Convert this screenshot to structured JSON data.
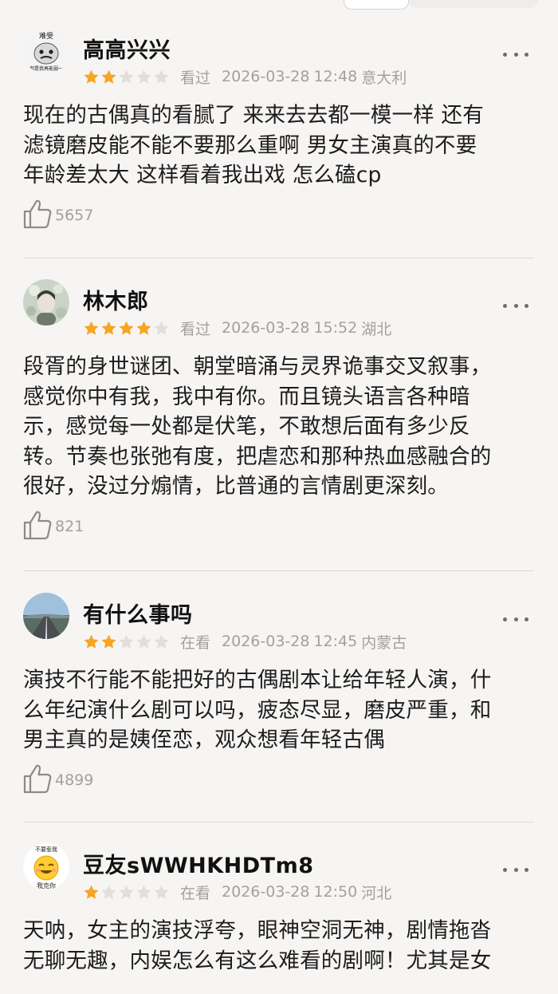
{
  "colors": {
    "background": "#f7f5f3",
    "star_filled": "#f5a623",
    "star_empty": "#e1dedb",
    "meta_text": "#a3a09d",
    "divider": "#dddad7"
  },
  "reviews": [
    {
      "username": "高高兴兴",
      "avatar": {
        "icon": "meme-avatar-icon",
        "caption_top": "难受",
        "caption_bottom": "但是我再能弱一"
      },
      "rating": 2,
      "status": "看过",
      "date": "2026-03-28",
      "time": "12:48",
      "location": "意大利",
      "content_lines": [
        "现在的古偶真的看腻了 来来去去都一模一样 还有",
        "滤镜磨皮能不能不要那么重啊 男女主演真的不要",
        "年龄差太大 这样看着我出戏 怎么磕cp"
      ],
      "likes": "5657",
      "like_icon": "thumbs-up-icon",
      "more_icon": "more-options-icon"
    },
    {
      "username": "林木郎",
      "avatar": {
        "icon": "portrait-avatar-icon"
      },
      "rating": 4,
      "status": "看过",
      "date": "2026-03-28",
      "time": "15:52",
      "location": "湖北",
      "content_lines": [
        "段胥的身世谜团、朝堂暗涌与灵界诡事交叉叙事，",
        "感觉你中有我，我中有你。而且镜头语言各种暗",
        "示，感觉每一处都是伏笔，不敢想后面有多少反",
        "转。节奏也张弛有度，把虐恋和那种热血感融合的",
        "很好，没过分煽情，比普通的言情剧更深刻。"
      ],
      "likes": "821",
      "like_icon": "thumbs-up-icon",
      "more_icon": "more-options-icon"
    },
    {
      "username": "有什么事吗",
      "avatar": {
        "icon": "road-landscape-avatar-icon"
      },
      "rating": 2,
      "status": "在看",
      "date": "2026-03-28",
      "time": "12:45",
      "location": "内蒙古",
      "content_lines": [
        "演技不行能不能把好的古偶剧本让给年轻人演，什",
        "么年纪演什么剧可以吗，疲态尽显，磨皮严重，和",
        "男主真的是姨侄恋，观众想看年轻古偶"
      ],
      "likes": "4899",
      "like_icon": "thumbs-up-icon",
      "more_icon": "more-options-icon"
    },
    {
      "username": "豆友sWWHKHDTm8",
      "avatar": {
        "icon": "smiley-emoji-avatar-icon",
        "caption_top": "不要惹我",
        "caption_bottom": "我克你"
      },
      "rating": 1,
      "status": "在看",
      "date": "2026-03-28",
      "time": "12:50",
      "location": "河北",
      "content_lines": [
        "天呐，女主的演技浮夸，眼神空洞无神，剧情拖沓",
        "无聊无趣，内娱怎么有这么难看的剧啊！尤其是女"
      ],
      "likes": "",
      "like_icon": "thumbs-up-icon",
      "more_icon": "more-options-icon"
    }
  ]
}
